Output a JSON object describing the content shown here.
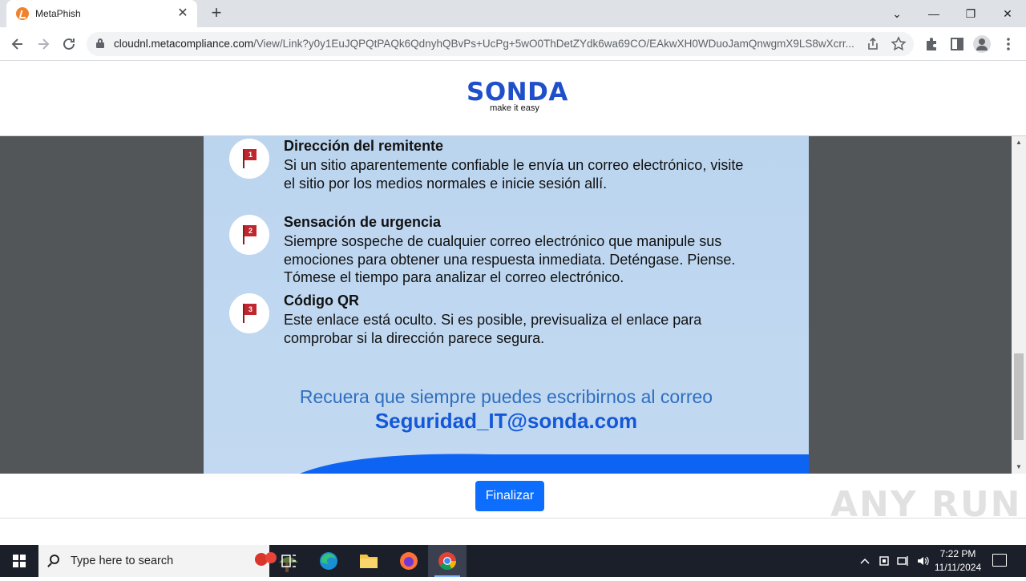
{
  "browser": {
    "tab_title": "MetaPhish",
    "tab_close": "✕",
    "new_tab": "+",
    "window_controls": {
      "minimize": "—",
      "restore": "❐",
      "close": "✕",
      "tab_list": "⌄"
    },
    "url_host": "cloudnl.metacompliance.com",
    "url_path": "/View/Link?y0y1EuJQPQtPAQk6QdnyhQBvPs+UcPg+5wO0ThDetZYdk6wa69CO/EAkwXH0WDuoJamQnwgmX9LS8wXcrr...",
    "icons": [
      "back-icon",
      "forward-icon",
      "reload-icon",
      "lock-icon",
      "share-icon",
      "bookmark-star-icon",
      "extensions-icon",
      "side-panel-icon",
      "profile-icon",
      "menu-icon"
    ]
  },
  "page": {
    "logo": {
      "word": "SONDA",
      "tagline": "make it easy"
    },
    "items": [
      {
        "number": "1",
        "title": "Dirección del remitente",
        "text": "Si un sitio aparentemente confiable le envía un correo electrónico, visite el sitio por los medios normales e inicie sesión allí."
      },
      {
        "number": "2",
        "title": "Sensación de urgencia",
        "text": "Siempre sospeche de cualquier correo electrónico que manipule sus emociones para obtener una respuesta inmediata. Deténgase. Piense. Tómese el tiempo para analizar el correo electrónico."
      },
      {
        "number": "3",
        "title": "Código QR",
        "text": "Este enlace está oculto. Si es posible, previsualiza el enlace para comprobar si la dirección parece segura."
      }
    ],
    "contact_line": "Recuera que siempre puedes escribirnos al correo",
    "email": "Seguridad_IT@sonda.com",
    "finish_button": "Finalizar",
    "scroll_position": 0.62
  },
  "watermark": "ANY RUN",
  "taskbar": {
    "search_placeholder": "Type here to search",
    "apps": [
      "task-view-icon",
      "edge-icon",
      "file-explorer-icon",
      "firefox-icon",
      "chrome-icon"
    ],
    "active_app": "chrome-icon",
    "time": "7:22 PM",
    "date": "11/11/2024"
  },
  "colors": {
    "brand_blue": "#1f4fc9",
    "button_blue": "#0d6efd",
    "flag_red": "#c0262d",
    "sheet_bg": "#bcd5ef",
    "email_blue": "#1458d9"
  }
}
